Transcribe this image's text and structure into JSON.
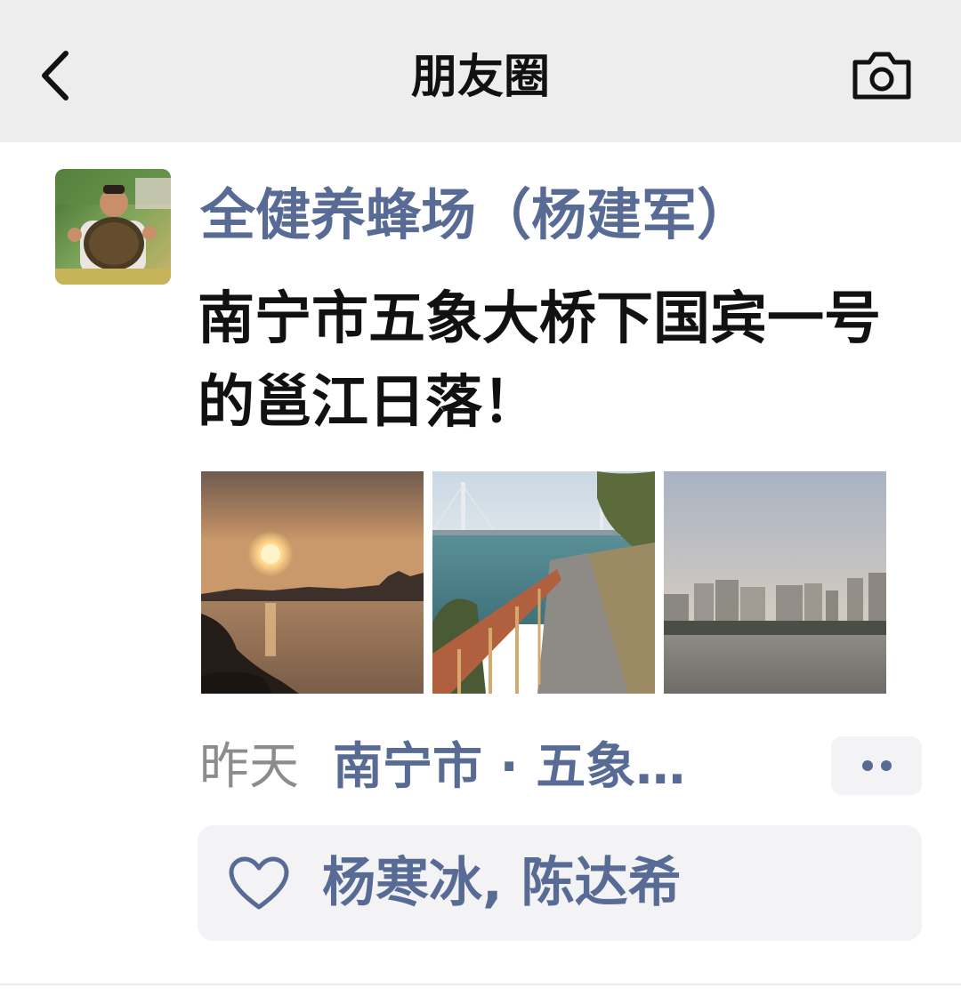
{
  "nav": {
    "title": "朋友圈",
    "back_icon": "chevron-left-icon",
    "camera_icon": "camera-icon"
  },
  "post": {
    "author": "全健养蜂场（杨建军）",
    "text": "南宁市五象大桥下国宾一号的邕江日落！",
    "photos": [
      {
        "description": "sunset-over-river"
      },
      {
        "description": "riverside-path-with-bridge"
      },
      {
        "description": "city-skyline-across-river"
      }
    ],
    "time": "昨天",
    "location": "南宁市 · 五象…",
    "more_icon": "more-dots-icon",
    "likes_icon": "heart-icon",
    "likes": "杨寒冰, 陈达希"
  },
  "colors": {
    "nav_bg": "#ededed",
    "link_blue": "#576b95",
    "text_black": "#111111",
    "meta_gray": "#8c8c8c",
    "likes_bg": "#f3f3f5"
  }
}
